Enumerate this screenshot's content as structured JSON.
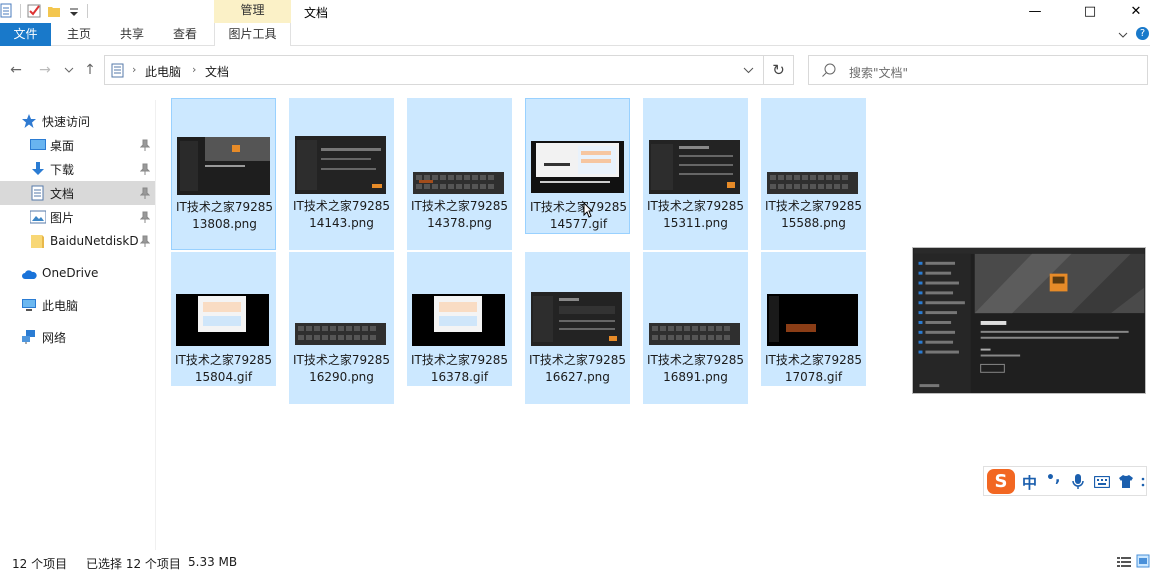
{
  "titlebar": {
    "context_tab": "管理",
    "window_title": "文档",
    "minimize": "—",
    "maximize": "□",
    "close": "✕"
  },
  "ribbon": {
    "tabs": [
      "文件",
      "主页",
      "共享",
      "查看",
      "图片工具"
    ]
  },
  "address": {
    "crumbs": [
      "此电脑",
      "文档"
    ],
    "search_placeholder": "搜索\"文档\""
  },
  "sidebar": {
    "items": [
      {
        "label": "快速访问",
        "icon": "star-icon"
      },
      {
        "label": "桌面",
        "icon": "desktop-icon",
        "pinned": true
      },
      {
        "label": "下载",
        "icon": "download-icon",
        "pinned": true
      },
      {
        "label": "文档",
        "icon": "document-icon",
        "pinned": true,
        "selected": true
      },
      {
        "label": "图片",
        "icon": "picture-icon",
        "pinned": true
      },
      {
        "label": "BaiduNetdiskD",
        "icon": "folder-icon",
        "pinned": true
      },
      {
        "label": "OneDrive",
        "icon": "cloud-icon"
      },
      {
        "label": "此电脑",
        "icon": "computer-icon"
      },
      {
        "label": "网络",
        "icon": "network-icon"
      }
    ]
  },
  "files": [
    {
      "name": "IT技术之家7928513808.png"
    },
    {
      "name": "IT技术之家7928514143.png"
    },
    {
      "name": "IT技术之家7928514378.png"
    },
    {
      "name": "IT技术之家7928514577.gif"
    },
    {
      "name": "IT技术之家7928515311.png"
    },
    {
      "name": "IT技术之家7928515588.png"
    },
    {
      "name": "IT技术之家7928515804.gif"
    },
    {
      "name": "IT技术之家7928516290.png"
    },
    {
      "name": "IT技术之家7928516378.gif"
    },
    {
      "name": "IT技术之家7928516627.png"
    },
    {
      "name": "IT技术之家7928516891.png"
    },
    {
      "name": "IT技术之家7928517078.gif"
    }
  ],
  "ime": {
    "logo": "S",
    "lang": "中",
    "punct": "•,"
  },
  "status": {
    "count": "12 个项目",
    "selected": "已选择 12 个项目",
    "size": "5.33 MB"
  }
}
